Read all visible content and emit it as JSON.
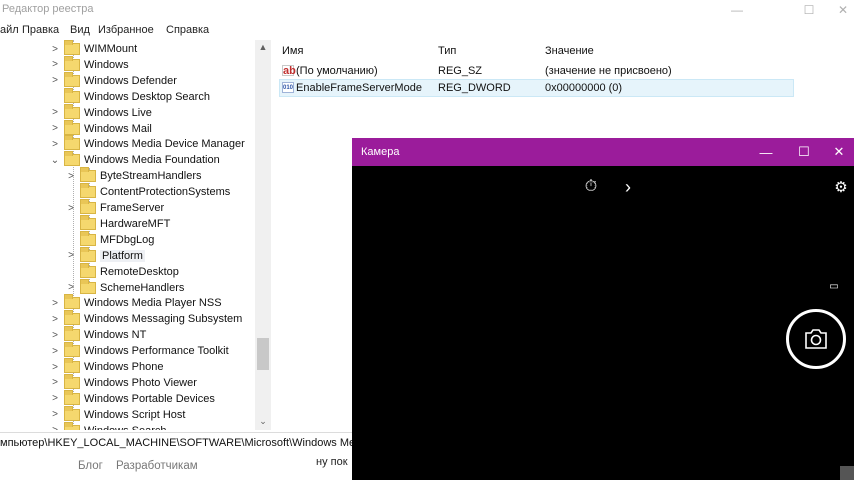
{
  "window": {
    "title": "Редактор реестра",
    "controls": {
      "minimize": "—",
      "maximize": "☐",
      "close": "✕"
    }
  },
  "menu": [
    "айл",
    "Правка",
    "Вид",
    "Избранное",
    "Справка"
  ],
  "tree": {
    "items": [
      {
        "label": "WIMMount",
        "level": 1,
        "expander": ">"
      },
      {
        "label": "Windows",
        "level": 1,
        "expander": ">"
      },
      {
        "label": "Windows Defender",
        "level": 1,
        "expander": ">"
      },
      {
        "label": "Windows Desktop Search",
        "level": 1,
        "expander": ""
      },
      {
        "label": "Windows Live",
        "level": 1,
        "expander": ">"
      },
      {
        "label": "Windows Mail",
        "level": 1,
        "expander": ">"
      },
      {
        "label": "Windows Media Device Manager",
        "level": 1,
        "expander": ">"
      },
      {
        "label": "Windows Media Foundation",
        "level": 1,
        "expander": "v"
      },
      {
        "label": "ByteStreamHandlers",
        "level": 2,
        "expander": ">"
      },
      {
        "label": "ContentProtectionSystems",
        "level": 2,
        "expander": ""
      },
      {
        "label": "FrameServer",
        "level": 2,
        "expander": ">"
      },
      {
        "label": "HardwareMFT",
        "level": 2,
        "expander": ""
      },
      {
        "label": "MFDbgLog",
        "level": 2,
        "expander": ""
      },
      {
        "label": "Platform",
        "level": 2,
        "expander": ">",
        "selected": true
      },
      {
        "label": "RemoteDesktop",
        "level": 2,
        "expander": ""
      },
      {
        "label": "SchemeHandlers",
        "level": 2,
        "expander": ">"
      },
      {
        "label": "Windows Media Player NSS",
        "level": 1,
        "expander": ">"
      },
      {
        "label": "Windows Messaging Subsystem",
        "level": 1,
        "expander": ">"
      },
      {
        "label": "Windows NT",
        "level": 1,
        "expander": ">"
      },
      {
        "label": "Windows Performance Toolkit",
        "level": 1,
        "expander": ">"
      },
      {
        "label": "Windows Phone",
        "level": 1,
        "expander": ">"
      },
      {
        "label": "Windows Photo Viewer",
        "level": 1,
        "expander": ">"
      },
      {
        "label": "Windows Portable Devices",
        "level": 1,
        "expander": ">"
      },
      {
        "label": "Windows Script Host",
        "level": 1,
        "expander": ">"
      },
      {
        "label": "Windows Search",
        "level": 1,
        "expander": ">"
      }
    ],
    "scroll_up": "▲",
    "scroll_down": "⌄"
  },
  "values": {
    "headers": {
      "name": "Имя",
      "type": "Тип",
      "data": "Значение"
    },
    "rows": [
      {
        "icon": "string-value-icon",
        "glyph": "ab",
        "name": "(По умолчанию)",
        "type": "REG_SZ",
        "data": "(значение не присвоено)"
      },
      {
        "icon": "dword-value-icon",
        "glyph": "010",
        "name": "EnableFrameServerMode",
        "type": "REG_DWORD",
        "data": "0x00000000 (0)",
        "selected": true
      }
    ]
  },
  "statusbar": {
    "path": "мпьютер\\HKEY_LOCAL_MACHINE\\SOFTWARE\\Microsoft\\Windows Media Fo"
  },
  "background_page": {
    "links": [
      "Блог",
      "Разработчикам"
    ],
    "text": "ну пок"
  },
  "camera": {
    "title": "Камера",
    "accent": "#9b1c9b",
    "controls": {
      "minimize": "—",
      "maximize": "☐",
      "close": "✕"
    },
    "icons": {
      "timer": "⏱",
      "chevron": "›",
      "settings": "⚙",
      "video_mode": "▭",
      "photo": "📷"
    }
  }
}
